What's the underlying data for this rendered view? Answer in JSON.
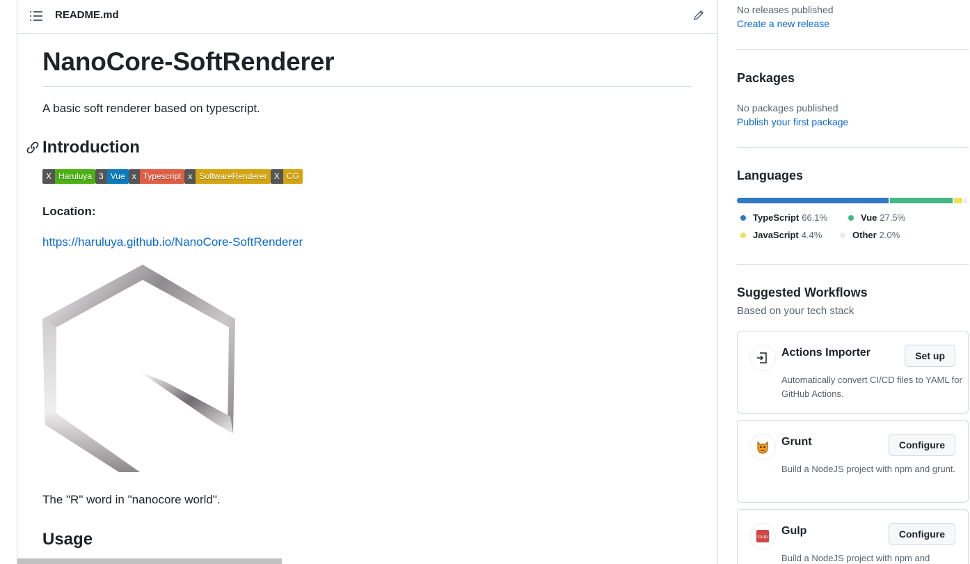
{
  "readme": {
    "filename": "README.md",
    "title": "NanoCore-SoftRenderer",
    "description": "A basic soft renderer based on typescript.",
    "intro_heading": "Introduction",
    "badges": [
      {
        "left": "X",
        "right": "Haruluya",
        "color": "#4caf13"
      },
      {
        "left": "3",
        "right": "Vue",
        "color": "#0a7bbb"
      },
      {
        "left": "x",
        "right": "Typescript",
        "color": "#e05d44"
      },
      {
        "left": "x",
        "right": "SoftwareRenderer",
        "color": "#d4a50f"
      },
      {
        "left": "X",
        "right": "CG",
        "color": "#d4a50f"
      }
    ],
    "location_label": "Location:",
    "location_url": "https://haruluya.github.io/NanoCore-SoftRenderer",
    "caption": "The \"R\" word in \"nanocore world\".",
    "usage_heading": "Usage"
  },
  "sidebar": {
    "releases": {
      "empty": "No releases published",
      "link": "Create a new release"
    },
    "packages": {
      "heading": "Packages",
      "empty": "No packages published",
      "link": "Publish your first package"
    },
    "languages": {
      "heading": "Languages",
      "items": [
        {
          "name": "TypeScript",
          "pct": "66.1%",
          "value": 66.1,
          "color": "#3178c6"
        },
        {
          "name": "Vue",
          "pct": "27.5%",
          "value": 27.5,
          "color": "#41b883"
        },
        {
          "name": "JavaScript",
          "pct": "4.4%",
          "value": 4.4,
          "color": "#f1e05a"
        },
        {
          "name": "Other",
          "pct": "2.0%",
          "value": 2.0,
          "color": "#ededed"
        }
      ]
    },
    "workflows": {
      "heading": "Suggested Workflows",
      "subheading": "Based on your tech stack",
      "cards": [
        {
          "title": "Actions Importer",
          "desc": "Automatically convert CI/CD files to YAML for GitHub Actions.",
          "button": "Set up",
          "icon": "actions-importer-icon"
        },
        {
          "title": "Grunt",
          "desc": "Build a NodeJS project with npm and grunt.",
          "button": "Configure",
          "icon": "grunt-icon"
        },
        {
          "title": "Gulp",
          "desc": "Build a NodeJS project with npm and",
          "button": "Configure",
          "icon": "gulp-icon"
        }
      ]
    }
  }
}
